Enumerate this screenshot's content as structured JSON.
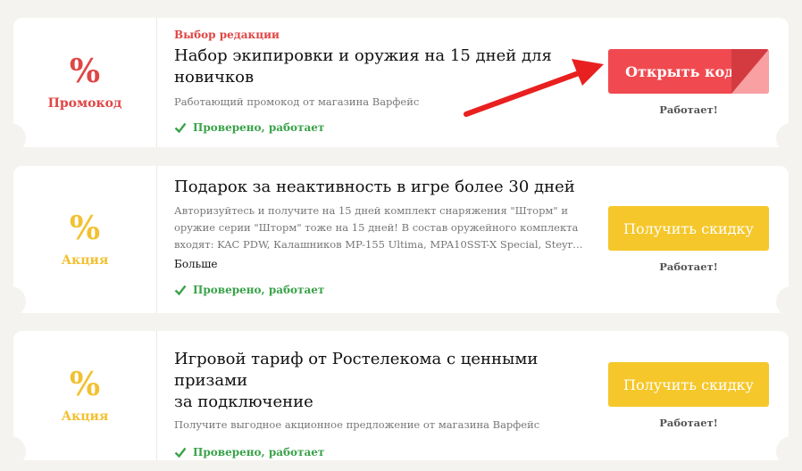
{
  "offers": [
    {
      "icon": "%",
      "kind": "Промокод",
      "editor_choice": "Выбор редакции",
      "title_line1": "Набор экипировки и оружия на 15 дней для",
      "title_line2": "новичков",
      "desc_line1": "Работающий промокод от магазина Варфейс",
      "verified": "Проверено, работает",
      "button": "Открыть код",
      "status": "Работает!"
    },
    {
      "icon": "%",
      "kind": "Акция",
      "title_line1": "Подарок за неактивность в игре более 30 дней",
      "desc_line1": "Авторизуйтесь и получите на 15 дней комплект снаряжения \"Шторм\" и",
      "desc_line2": "оружие серии \"Шторм\" тоже на 15 дней! В состав оружейного комплекта",
      "desc_line3": "входят: KAC PDW, Калашников MP-155 Ultima, MPA10SST-X Special, Steyr…",
      "more": "Больше",
      "verified": "Проверено, работает",
      "button": "Получить скидку",
      "status": "Работает!"
    },
    {
      "icon": "%",
      "kind": "Акция",
      "title_line1": "Игровой тариф от Ростелекома с ценными призами",
      "title_line2": "за подключение",
      "desc_line1": "Получите выгодное акционное предложение от магазина Варфейс",
      "verified": "Проверено, работает",
      "button": "Получить скидку",
      "status": "Работает!"
    }
  ],
  "colors": {
    "promo_red": "#e04545",
    "action_yellow": "#f2c131",
    "verified_green": "#3aa34a",
    "button_red": "#f04a50",
    "button_yellow": "#f5c72a"
  }
}
